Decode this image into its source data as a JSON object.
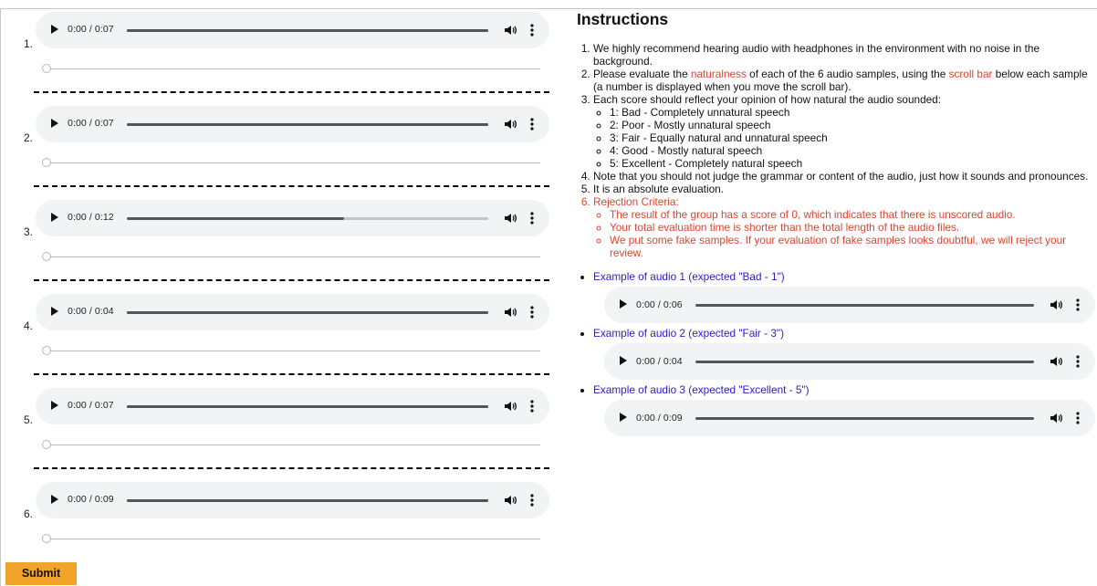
{
  "samples": [
    {
      "number": "1.",
      "time": "0:00 / 0:07",
      "buffered": false,
      "progress": 0
    },
    {
      "number": "2.",
      "time": "0:00 / 0:07",
      "buffered": false,
      "progress": 0
    },
    {
      "number": "3.",
      "time": "0:00 / 0:12",
      "buffered": true,
      "progress": 0.6
    },
    {
      "number": "4.",
      "time": "0:00 / 0:04",
      "buffered": false,
      "progress": 0
    },
    {
      "number": "5.",
      "time": "0:00 / 0:07",
      "buffered": false,
      "progress": 0
    },
    {
      "number": "6.",
      "time": "0:00 / 0:09",
      "buffered": false,
      "progress": 0
    }
  ],
  "submit_label": "Submit",
  "instructions": {
    "title": "Instructions",
    "item1": "We highly recommend hearing audio with headphones in the environment with no noise in the background.",
    "item2_a": "Please evaluate the ",
    "item2_b": "naturalness",
    "item2_c": " of each of the 6 audio samples, using the ",
    "item2_d": "scroll bar",
    "item2_e": " below each sample (a number is displayed when you move the scroll bar).",
    "item3": "Each score should reflect your opinion of how natural the audio sounded:",
    "scores": [
      "1: Bad - Completely unnatural speech",
      "2: Poor - Mostly unnatural speech",
      "3: Fair - Equally natural and unnatural speech",
      "4: Good - Mostly natural speech",
      "5: Excellent - Completely natural speech"
    ],
    "item4": "Note that you should not judge the grammar or content of the audio, just how it sounds and pronounces.",
    "item5": "It is an absolute evaluation.",
    "item6": "Rejection Criteria:",
    "rejection": [
      "The result of the group has a score of 0, which indicates that there is unscored audio.",
      "Your total evaluation time is shorter than the total length of the audio files.",
      "We put some fake samples. If your evaluation of fake samples looks doubtful, we will reject your review."
    ],
    "examples": [
      {
        "label": "Example of audio 1 (expected \"Bad - 1\")",
        "time": "0:00 / 0:06"
      },
      {
        "label": "Example of audio 2 (expected \"Fair - 3\")",
        "time": "0:00 / 0:04"
      },
      {
        "label": "Example of audio 3 (expected \"Excellent - 5\")",
        "time": "0:00 / 0:09"
      }
    ]
  },
  "colors": {
    "accent_red": "#e0442f",
    "link_blue": "#2a1bd6",
    "submit_orange": "#f2a32a",
    "player_bg": "#f1f3f4"
  }
}
